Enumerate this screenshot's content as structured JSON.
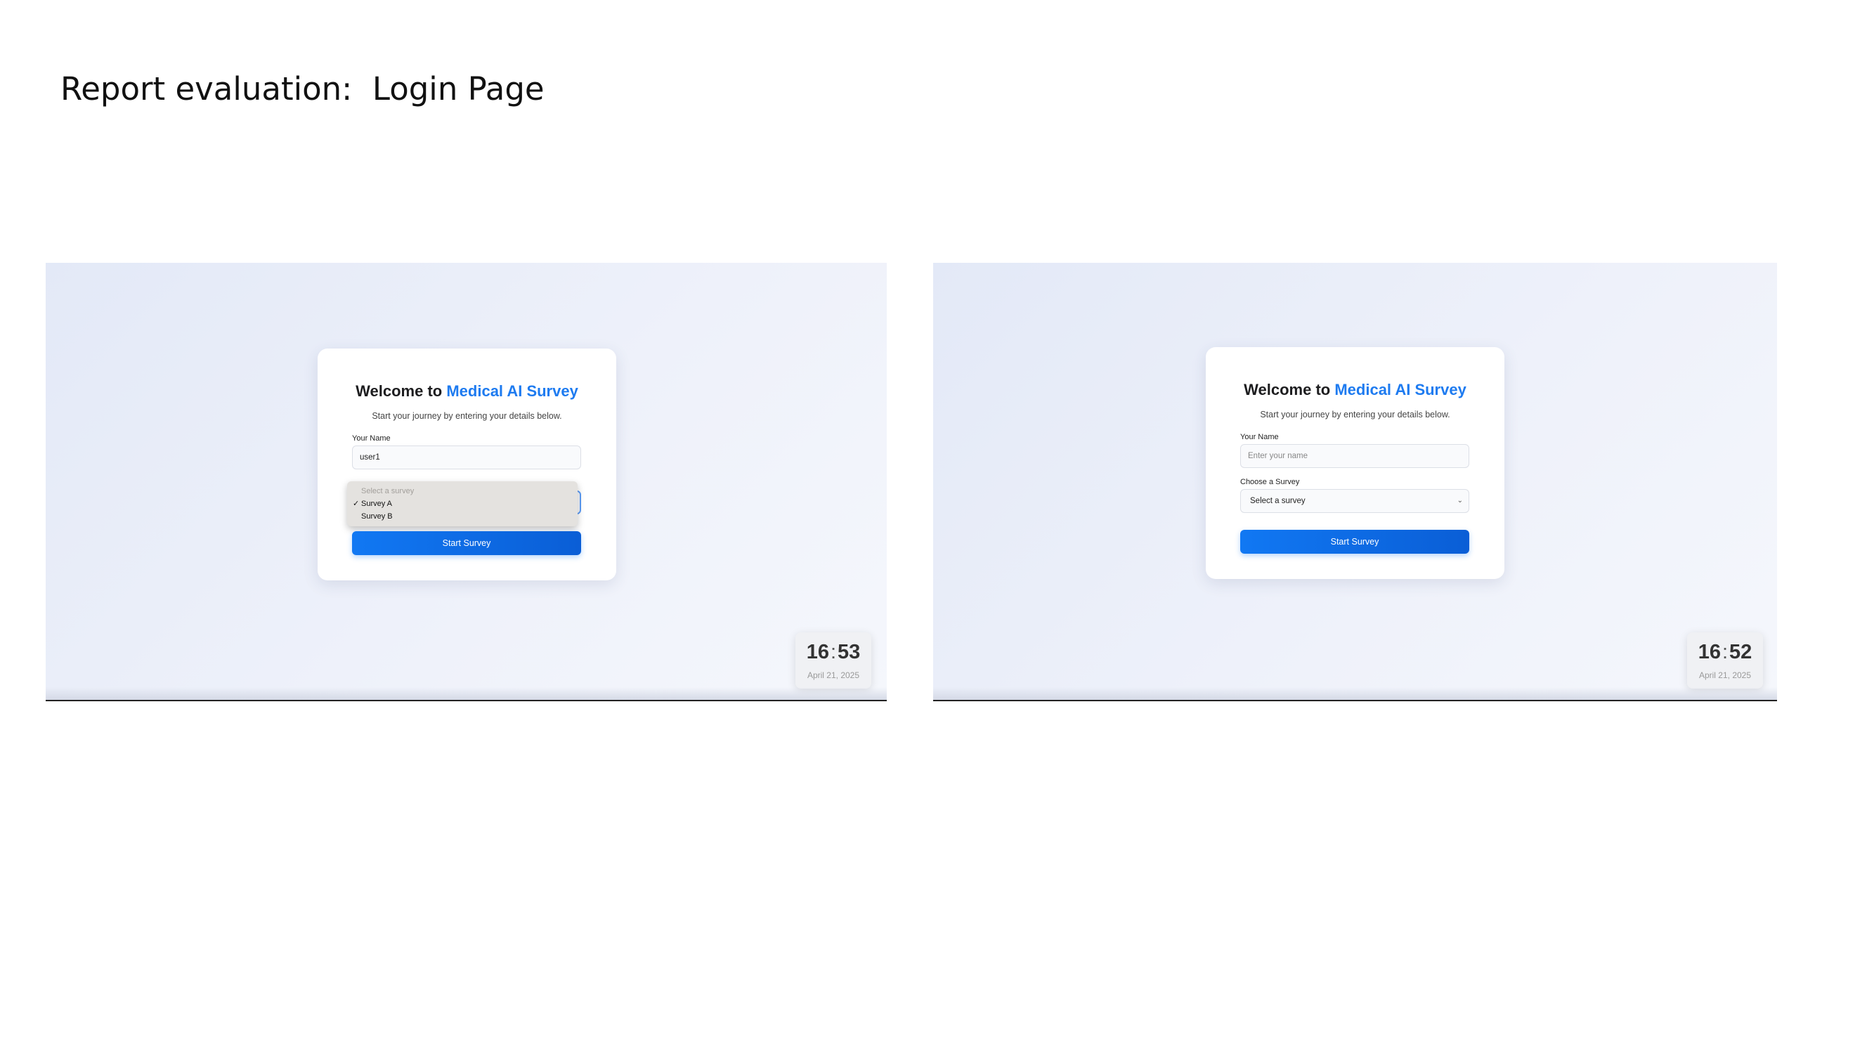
{
  "slide": {
    "title": "Report evaluation:  Login Page"
  },
  "left_screenshot": {
    "welcome_prefix": "Welcome to ",
    "brand": "Medical AI Survey",
    "subtitle": "Start your journey by entering your details below.",
    "name_label": "Your Name",
    "name_value": "user1",
    "dropdown": {
      "placeholder": "Select a survey",
      "options": [
        "Survey A",
        "Survey B"
      ],
      "selected": "Survey A",
      "check": "✓"
    },
    "button_label": "Start Survey",
    "clock": {
      "hours": "16",
      "separator": ":",
      "minutes": "53",
      "date": "April 21, 2025"
    }
  },
  "right_screenshot": {
    "welcome_prefix": "Welcome to ",
    "brand": "Medical AI Survey",
    "subtitle": "Start your journey by entering your details below.",
    "name_label": "Your Name",
    "name_placeholder": "Enter your name",
    "survey_label": "Choose a Survey",
    "survey_value": "Select a survey",
    "chevron": "⌄",
    "button_label": "Start Survey",
    "clock": {
      "hours": "16",
      "separator": ":",
      "minutes": "52",
      "date": "April 21, 2025"
    }
  },
  "colors": {
    "brand": "#1e7bf0",
    "button": "#1178f3",
    "page_gradient_start": "#e3e9f7",
    "page_gradient_end": "#f5f7fc"
  }
}
